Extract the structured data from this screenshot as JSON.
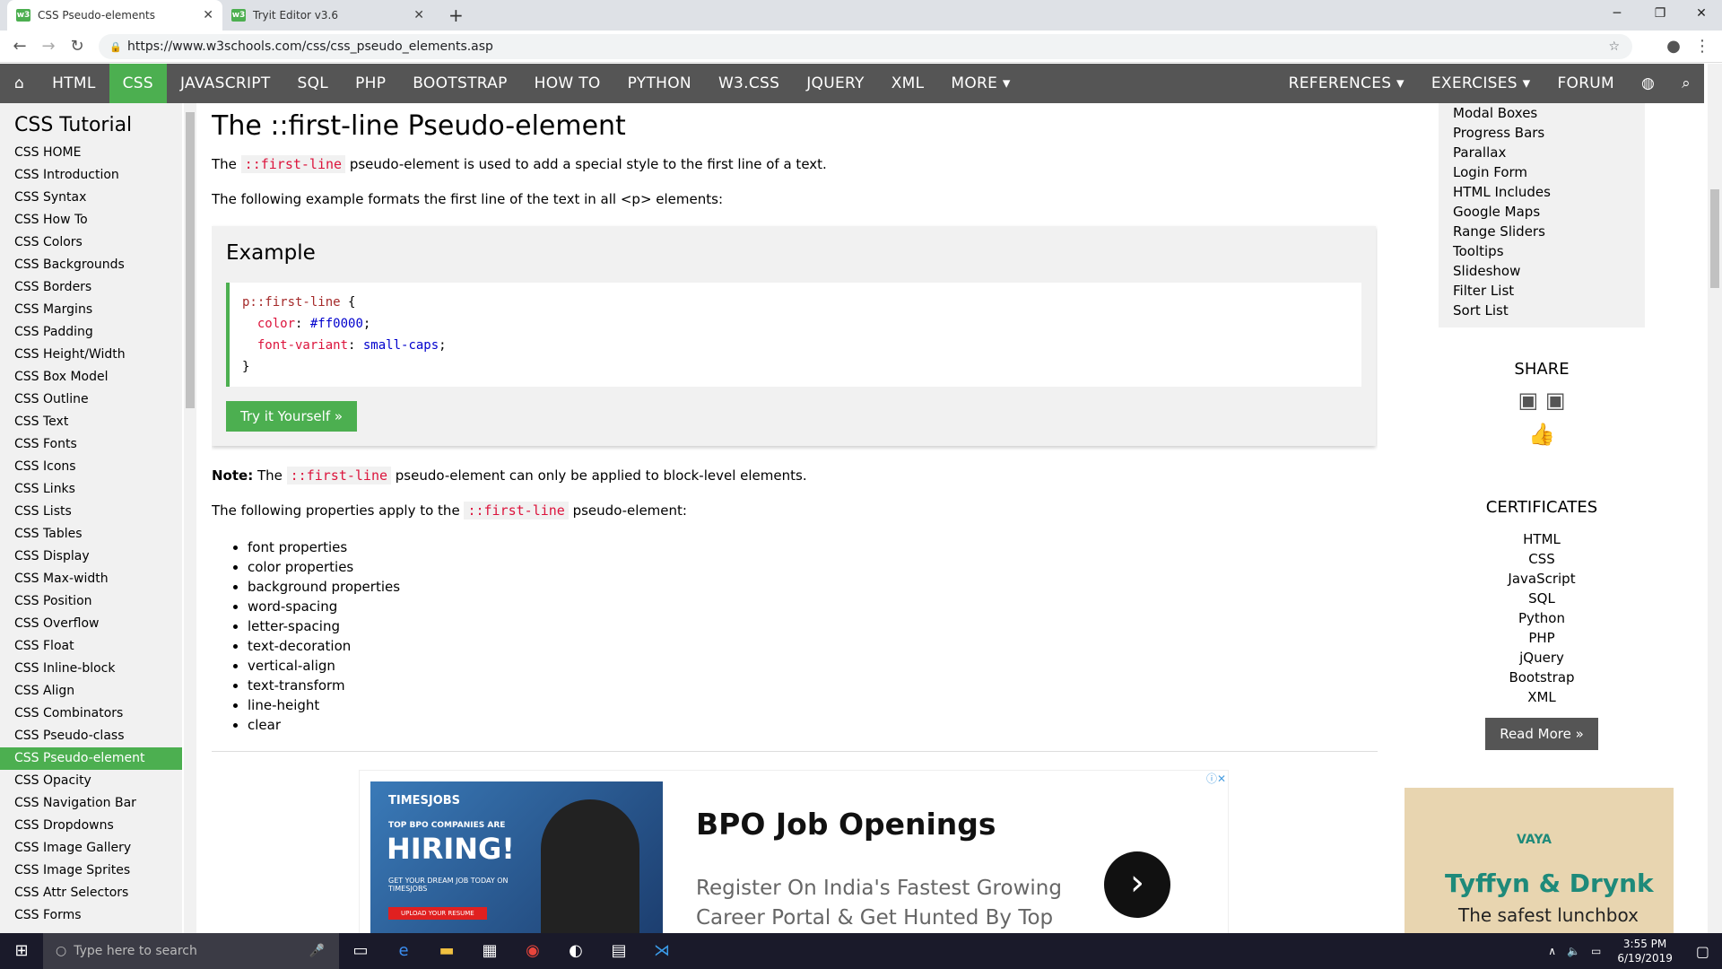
{
  "browser": {
    "tabs": [
      {
        "title": "CSS Pseudo-elements",
        "favicon": "w3"
      },
      {
        "title": "Tryit Editor v3.6",
        "favicon": "w3"
      }
    ],
    "url": "https://www.w3schools.com/css/css_pseudo_elements.asp",
    "new_tab": "+"
  },
  "topnav": {
    "items": [
      "HTML",
      "CSS",
      "JAVASCRIPT",
      "SQL",
      "PHP",
      "BOOTSTRAP",
      "HOW TO",
      "PYTHON",
      "W3.CSS",
      "JQUERY",
      "XML",
      "MORE ▾"
    ],
    "right": [
      "REFERENCES ▾",
      "EXERCISES ▾",
      "FORUM"
    ]
  },
  "sidebar": {
    "title": "CSS Tutorial",
    "items": [
      "CSS HOME",
      "CSS Introduction",
      "CSS Syntax",
      "CSS How To",
      "CSS Colors",
      "CSS Backgrounds",
      "CSS Borders",
      "CSS Margins",
      "CSS Padding",
      "CSS Height/Width",
      "CSS Box Model",
      "CSS Outline",
      "CSS Text",
      "CSS Fonts",
      "CSS Icons",
      "CSS Links",
      "CSS Lists",
      "CSS Tables",
      "CSS Display",
      "CSS Max-width",
      "CSS Position",
      "CSS Overflow",
      "CSS Float",
      "CSS Inline-block",
      "CSS Align",
      "CSS Combinators",
      "CSS Pseudo-class",
      "CSS Pseudo-element",
      "CSS Opacity",
      "CSS Navigation Bar",
      "CSS Dropdowns",
      "CSS Image Gallery",
      "CSS Image Sprites",
      "CSS Attr Selectors",
      "CSS Forms"
    ],
    "active": "CSS Pseudo-element"
  },
  "main": {
    "title": "The ::first-line Pseudo-element",
    "p1_before": "The ",
    "p1_code": "::first-line",
    "p1_after": " pseudo-element is used to add a special style to the first line of a text.",
    "p2": "The following example formats the first line of the text in all <p> elements:",
    "example_title": "Example",
    "code": {
      "selector": "p::first-line",
      "open": " {",
      "line1_prop": "color",
      "line1_val": "#ff0000",
      "line2_prop": "font-variant",
      "line2_val": "small-caps",
      "close": "}"
    },
    "tryit": "Try it Yourself »",
    "note_label": "Note:",
    "note_before": " The ",
    "note_code": "::first-line",
    "note_after": " pseudo-element can only be applied to block-level elements.",
    "p3_before": "The following properties apply to the ",
    "p3_code": "::first-line",
    "p3_after": " pseudo-element:",
    "properties": [
      "font properties",
      "color properties",
      "background properties",
      "word-spacing",
      "letter-spacing",
      "text-decoration",
      "vertical-align",
      "text-transform",
      "line-height",
      "clear"
    ]
  },
  "ad": {
    "brand": "TIMESJOBS",
    "small": "TOP BPO COMPANIES ARE",
    "hiring": "HIRING!",
    "dream": "GET YOUR DREAM JOB TODAY ON TIMESJOBS",
    "upload": "UPLOAD YOUR RESUME",
    "headline": "BPO Job Openings",
    "sub1": "Register On India's Fastest Growing",
    "sub2": "Career Portal & Get Hunted By Top"
  },
  "rightcol": {
    "links": [
      "Modal Boxes",
      "Progress Bars",
      "Parallax",
      "Login Form",
      "HTML Includes",
      "Google Maps",
      "Range Sliders",
      "Tooltips",
      "Slideshow",
      "Filter List",
      "Sort List"
    ],
    "share_title": "SHARE",
    "certs_title": "CERTIFICATES",
    "certs": [
      "HTML",
      "CSS",
      "JavaScript",
      "SQL",
      "Python",
      "PHP",
      "jQuery",
      "Bootstrap",
      "XML"
    ],
    "read_more": "Read More »",
    "ad2_brand": "VAYA",
    "ad2_t1": "Tyffyn & Drynk",
    "ad2_t2": "The safest lunchbox"
  },
  "taskbar": {
    "search_placeholder": "Type here to search",
    "time": "3:55 PM",
    "date": "6/19/2019"
  }
}
